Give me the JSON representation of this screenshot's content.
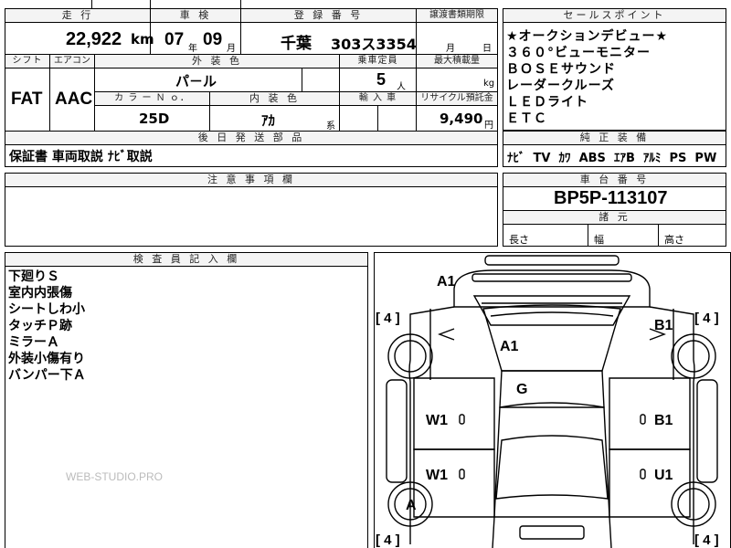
{
  "headers": {
    "mileage": "走 行",
    "inspection": "車 検",
    "registration": "登 録 番 号",
    "transfer_deadline": "譲渡書類期限",
    "sales_points": "セールスポイント",
    "shift": "シフト",
    "aircon": "エアコン",
    "exterior_color": "外 装 色",
    "capacity": "乗車定員",
    "max_load": "最大積載量",
    "color_no": "カ ラ ー Ｎ ｏ．",
    "interior_color": "内 装 色",
    "import": "輸 入 車",
    "recycle": "リサイクル預託金",
    "accessories": "後 日 発 送 部 品",
    "standard_equipment": "純 正 装 備",
    "notes": "注 意 事 項 欄",
    "chassis_no": "車 台 番 号",
    "specs": "諸 元",
    "inspector_notes": "検 査 員 記 入 欄"
  },
  "values": {
    "mileage": "22,922",
    "mileage_unit": "km",
    "inspection_year": "07",
    "year_label": "年",
    "inspection_month": "09",
    "month_label": "月",
    "registration_region": "千葉",
    "registration_number": "303ス3354",
    "transfer_month_label": "月",
    "transfer_day_label": "日",
    "shift": "FAT",
    "aircon": "AAC",
    "exterior_color": "パ－ル",
    "capacity": "5",
    "capacity_unit": "人",
    "max_load_unit": "kg",
    "color_no": "25D",
    "interior_color": "ｱｶ",
    "interior_suffix": "系",
    "recycle": "9,490",
    "recycle_unit": "円",
    "accessories": "保証書 車両取説 ﾅﾋﾞ取説",
    "standard_equipment": "ﾅﾋﾞ  TV  ｶﾜ  ABS  ｴｱB  ｱﾙﾐ  PS  PW",
    "chassis_no": "BP5P-113107",
    "spec_length": "長さ",
    "spec_width": "幅",
    "spec_height": "高さ"
  },
  "sales_points": [
    "★オークションデビュー★",
    "３６０°ビューモニター",
    "ＢＯＳＥサウンド",
    "レーダークルーズ",
    "ＬＥＤライト",
    "ＥＴＣ"
  ],
  "inspector_notes": [
    "下廻りＳ",
    "室内内張傷",
    "シートしわ小",
    "タッチＰ跡",
    "ミラーＡ",
    "外装小傷有り",
    "バンパー下Ａ"
  ],
  "diagram": {
    "front_bumper": "A1",
    "hood": "A1",
    "roof": "G",
    "right_front_fender": "B1",
    "right_front_door": "B1",
    "right_rear_door": "U1",
    "left_front_door": "W1",
    "left_rear_door": "W1",
    "left_rear_wheel": "A",
    "tire_lf": "4",
    "tire_rf": "4",
    "tire_lr": "4",
    "tire_rr": "4"
  },
  "watermark": "WEB-STUDIO.PRO"
}
